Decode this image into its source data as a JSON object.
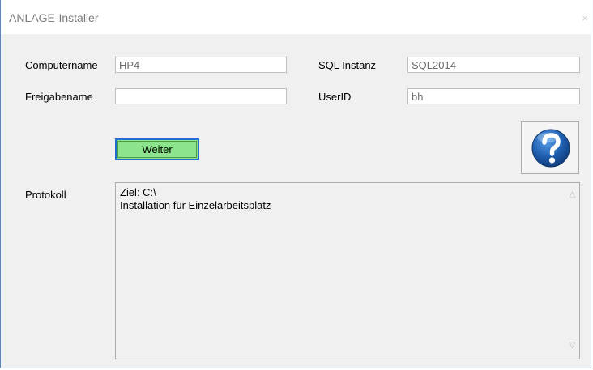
{
  "window": {
    "title": "ANLAGE-Installer",
    "close_glyph": "×"
  },
  "form": {
    "computername_label": "Computername",
    "computername_value": "HP4",
    "freigabename_label": "Freigabename",
    "freigabename_value": "",
    "sql_instanz_label": "SQL Instanz",
    "sql_instanz_value": "SQL2014",
    "userid_label": "UserID",
    "userid_value": "bh"
  },
  "actions": {
    "weiter_label": "Weiter",
    "help_icon": "question-mark-icon"
  },
  "protokoll": {
    "label": "Protokoll",
    "lines": [
      "Ziel: C:\\",
      "Installation für Einzelarbeitsplatz"
    ]
  },
  "colors": {
    "weiter_bg": "#8ce48c",
    "focus_border": "#1e6fd0",
    "help_circle": "#1f5fb0"
  }
}
